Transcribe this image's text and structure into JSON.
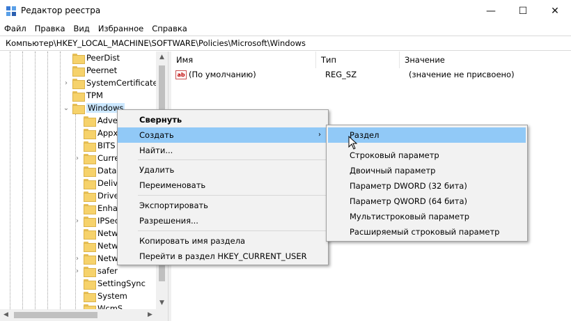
{
  "window": {
    "title": "Редактор реестра",
    "controls": {
      "minimize": "—",
      "maximize": "☐",
      "close": "✕"
    }
  },
  "menubar": [
    "Файл",
    "Правка",
    "Вид",
    "Избранное",
    "Справка"
  ],
  "address": "Компьютер\\HKEY_LOCAL_MACHINE\\SOFTWARE\\Policies\\Microsoft\\Windows",
  "tree": {
    "top_items": [
      "PeerDist",
      "Peernet",
      "SystemCertificates",
      "TPM",
      "Windows"
    ],
    "child_items": [
      "Adve",
      "Appx",
      "BITS",
      "Curre",
      "DataC",
      "Deliv",
      "Drive",
      "Enha",
      "IPSec",
      "Netw",
      "Netw",
      "Netw",
      "safer",
      "SettingSync",
      "System",
      "WcmS"
    ]
  },
  "values": {
    "columns": [
      "Имя",
      "Тип",
      "Значение"
    ],
    "rows": [
      {
        "icon": "ab",
        "name": "(По умолчанию)",
        "type": "REG_SZ",
        "value": "(значение не присвоено)"
      }
    ]
  },
  "context_menu": {
    "items": [
      "Свернуть",
      "Создать",
      "Найти...",
      "Удалить",
      "Переименовать",
      "Экспортировать",
      "Разрешения...",
      "Копировать имя раздела",
      "Перейти в раздел HKEY_CURRENT_USER"
    ],
    "submenu_arrow": "›"
  },
  "submenu": {
    "items": [
      "Раздел",
      "Строковый параметр",
      "Двоичный параметр",
      "Параметр DWORD (32 бита)",
      "Параметр QWORD (64 бита)",
      "Мультистроковый параметр",
      "Расширяемый строковый параметр"
    ]
  },
  "colors": {
    "highlight": "#91c9f7",
    "selection": "#cce8ff",
    "folder": "#f6d26b"
  }
}
